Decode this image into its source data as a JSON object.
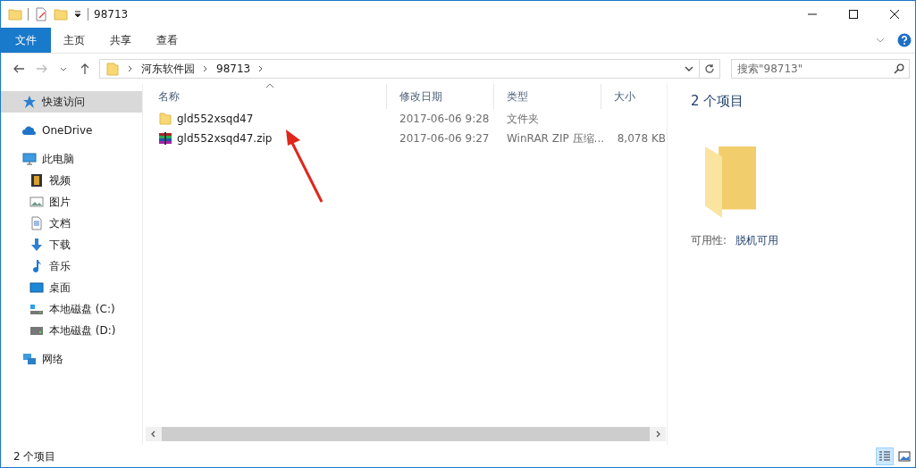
{
  "window": {
    "title": "98713"
  },
  "ribbon_tabs": [
    {
      "label": "文件",
      "kind": "file"
    },
    {
      "label": "主页",
      "kind": "tab"
    },
    {
      "label": "共享",
      "kind": "tab"
    },
    {
      "label": "查看",
      "kind": "tab"
    }
  ],
  "address": {
    "crumbs": [
      "河东软件园",
      "98713"
    ]
  },
  "search": {
    "placeholder": "搜索\"98713\""
  },
  "sidebar": {
    "items": [
      {
        "label": "快速访问",
        "kind": "star",
        "selected": true
      },
      {
        "label": "OneDrive",
        "kind": "cloud",
        "selected": false
      },
      {
        "label": "此电脑",
        "kind": "pc",
        "selected": false,
        "children": [
          {
            "label": "视频",
            "kind": "video",
            "selected": false
          },
          {
            "label": "图片",
            "kind": "image",
            "selected": false
          },
          {
            "label": "文档",
            "kind": "doc",
            "selected": false
          },
          {
            "label": "下载",
            "kind": "download",
            "selected": false
          },
          {
            "label": "音乐",
            "kind": "music",
            "selected": false
          },
          {
            "label": "桌面",
            "kind": "desktop",
            "selected": false
          },
          {
            "label": "本地磁盘 (C:)",
            "kind": "sysdrive",
            "selected": false
          },
          {
            "label": "本地磁盘 (D:)",
            "kind": "drive",
            "selected": false
          }
        ]
      },
      {
        "label": "网络",
        "kind": "network",
        "selected": false
      }
    ]
  },
  "table": {
    "columns": [
      "名称",
      "修改日期",
      "类型",
      "大小"
    ],
    "rows": [
      {
        "kind": "folder",
        "cells": [
          "gld552xsqd47",
          "2017-06-06 9:28",
          "文件夹",
          ""
        ]
      },
      {
        "kind": "zip",
        "cells": [
          "gld552xsqd47.zip",
          "2017-06-06 9:27",
          "WinRAR ZIP 压缩...",
          "8,078 KB"
        ]
      }
    ]
  },
  "details": {
    "count": "2 个项目",
    "property": "可用性:",
    "value": "脱机可用"
  },
  "status_bar": {
    "text": "2 个项目",
    "views": [
      {
        "kind": "details",
        "selected": true
      },
      {
        "kind": "large",
        "selected": false
      }
    ]
  }
}
